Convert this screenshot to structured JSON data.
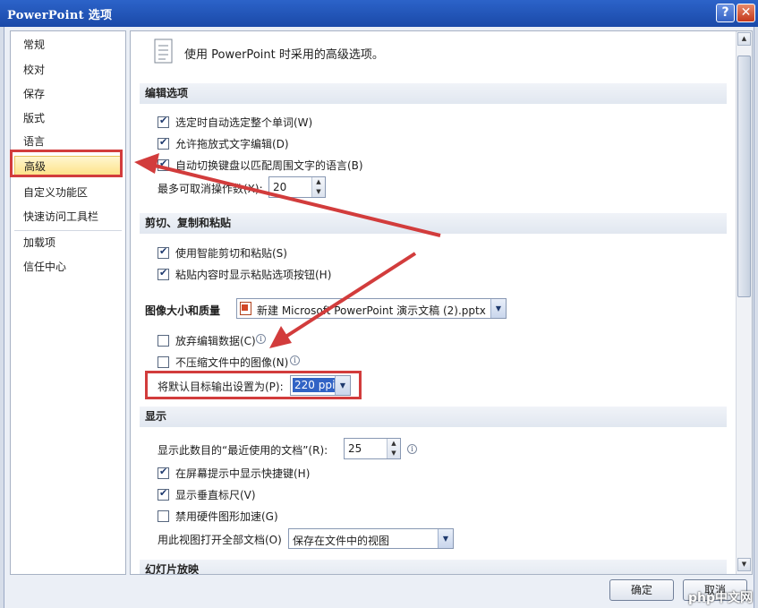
{
  "window": {
    "title": "PowerPoint 选项",
    "help_label": "?",
    "close_label": "✕"
  },
  "nav": {
    "items": [
      {
        "label": "常规"
      },
      {
        "label": "校对"
      },
      {
        "label": "保存"
      },
      {
        "label": "版式"
      },
      {
        "label": "语言"
      },
      {
        "label": "高级"
      },
      {
        "label": "自定义功能区"
      },
      {
        "label": "快速访问工具栏"
      },
      {
        "label": "加载项"
      },
      {
        "label": "信任中心"
      }
    ],
    "active_index": 5
  },
  "content": {
    "header": "使用 PowerPoint 时采用的高级选项。",
    "edit": {
      "title": "编辑选项",
      "opt1": "选定时自动选定整个单词(W)",
      "opt2": "允许拖放式文字编辑(D)",
      "opt3": "自动切换键盘以匹配周围文字的语言(B)",
      "undo_label": "最多可取消操作数(X):",
      "undo_value": "20"
    },
    "clipboard": {
      "title": "剪切、复制和粘贴",
      "opt1": "使用智能剪切和粘贴(S)",
      "opt2": "粘贴内容时显示粘贴选项按钮(H)"
    },
    "image": {
      "title": "图像大小和质量",
      "file": "新建 Microsoft PowerPoint 演示文稿 (2).pptx",
      "opt1": "放弃编辑数据(C)",
      "opt2": "不压缩文件中的图像(N)",
      "ppi_label": "将默认目标输出设置为(P):",
      "ppi_value": "220 ppi"
    },
    "display": {
      "title": "显示",
      "recent_label": "显示此数目的“最近使用的文档”(R):",
      "recent_value": "25",
      "opt1": "在屏幕提示中显示快捷键(H)",
      "opt2": "显示垂直标尺(V)",
      "opt3": "禁用硬件图形加速(G)",
      "view_label": "用此视图打开全部文档(O)",
      "view_value": "保存在文件中的视图"
    },
    "slideshow_title": "幻灯片放映"
  },
  "buttons": {
    "ok": "确定",
    "cancel": "取消"
  },
  "watermark": "php中文网",
  "colors": {
    "highlight": "#d23c3c",
    "active_nav": "#fde38a",
    "title_bar": "#1f55c0"
  }
}
